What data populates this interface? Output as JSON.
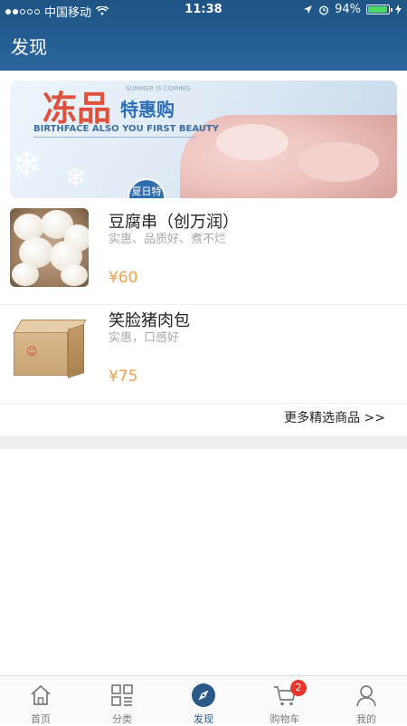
{
  "status_bar": {
    "carrier": "中国移动",
    "time": "11:38",
    "battery": "94%"
  },
  "nav": {
    "title": "发现"
  },
  "banner": {
    "headline": "冻品",
    "subheadline": "特惠购",
    "tagline": "SUMMER IS COMING",
    "english": "BIRTHFACE ALSO YOU FIRST BEAUTY",
    "badge": "夏日特惠"
  },
  "products": [
    {
      "name": "豆腐串（创万润）",
      "desc": "实惠、品质好、煮不烂",
      "price": "¥60",
      "image": "steamed-buns"
    },
    {
      "name": "笑脸猪肉包",
      "desc": "实惠，口感好",
      "price": "¥75",
      "image": "carton-box"
    }
  ],
  "more_link": "更多精选商品 >>",
  "tabbar": {
    "items": [
      {
        "label": "首页",
        "icon": "home-icon"
      },
      {
        "label": "分类",
        "icon": "category-icon"
      },
      {
        "label": "发现",
        "icon": "compass-icon",
        "active": true
      },
      {
        "label": "购物车",
        "icon": "cart-icon",
        "badge": "2"
      },
      {
        "label": "我的",
        "icon": "user-icon"
      }
    ]
  },
  "colors": {
    "header": "#245d92",
    "price": "#f0a04b",
    "badge": "#e8362d",
    "active_tab": "#2a5a8a"
  }
}
